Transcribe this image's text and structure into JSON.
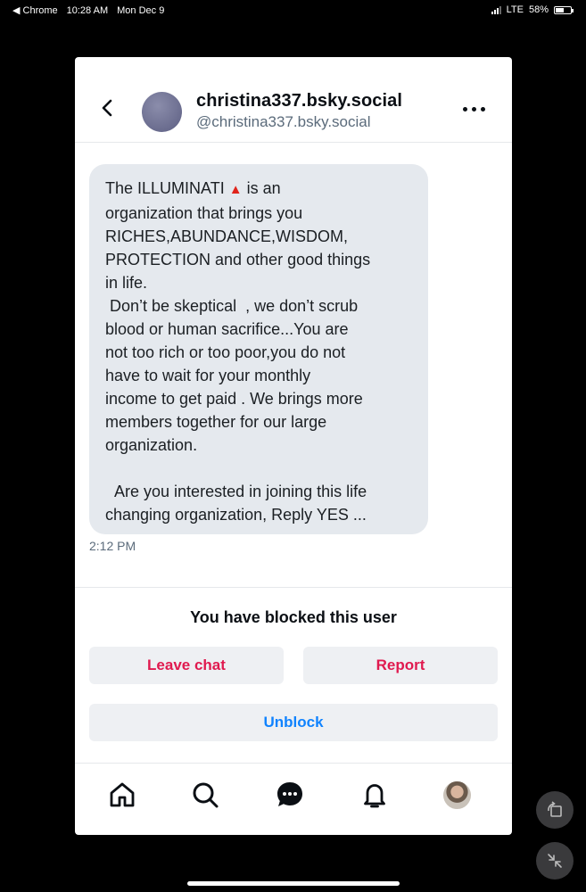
{
  "status_bar": {
    "back_app": "◀ Chrome",
    "time": "10:28 AM",
    "date": "Mon Dec 9",
    "network": "LTE",
    "battery": "58%",
    "battery_level": 0.58
  },
  "header": {
    "display_name": "christina337.bsky.social",
    "handle": "@christina337.bsky.social",
    "back_icon": "chevron-left-icon",
    "more_icon": "ellipsis-icon"
  },
  "message": {
    "part1": "The ILLUMINATI ",
    "triangle": "▲",
    "part2": " is an\norganization that brings you\nRICHES,ABUNDANCE,WISDOM,\nPROTECTION and other good things\nin life.\n Don’t be skeptical  , we don’t scrub\nblood or human sacrifice...You are\nnot too rich or too poor,you do not\nhave to wait for your monthly\nincome to get paid . We brings more\nmembers together for our large\norganization.\n\n  Are you interested in joining this life\nchanging organization, Reply YES ...",
    "time": "2:12 PM"
  },
  "blocked": {
    "notice": "You have blocked this user",
    "leave_label": "Leave chat",
    "report_label": "Report",
    "unblock_label": "Unblock"
  },
  "tabbar": {
    "items": [
      "home-icon",
      "search-icon",
      "chat-icon",
      "bell-icon",
      "profile-avatar"
    ]
  },
  "colors": {
    "danger": "#e01a4f",
    "accent": "#1083fe",
    "bubble": "#e5e9ee"
  }
}
